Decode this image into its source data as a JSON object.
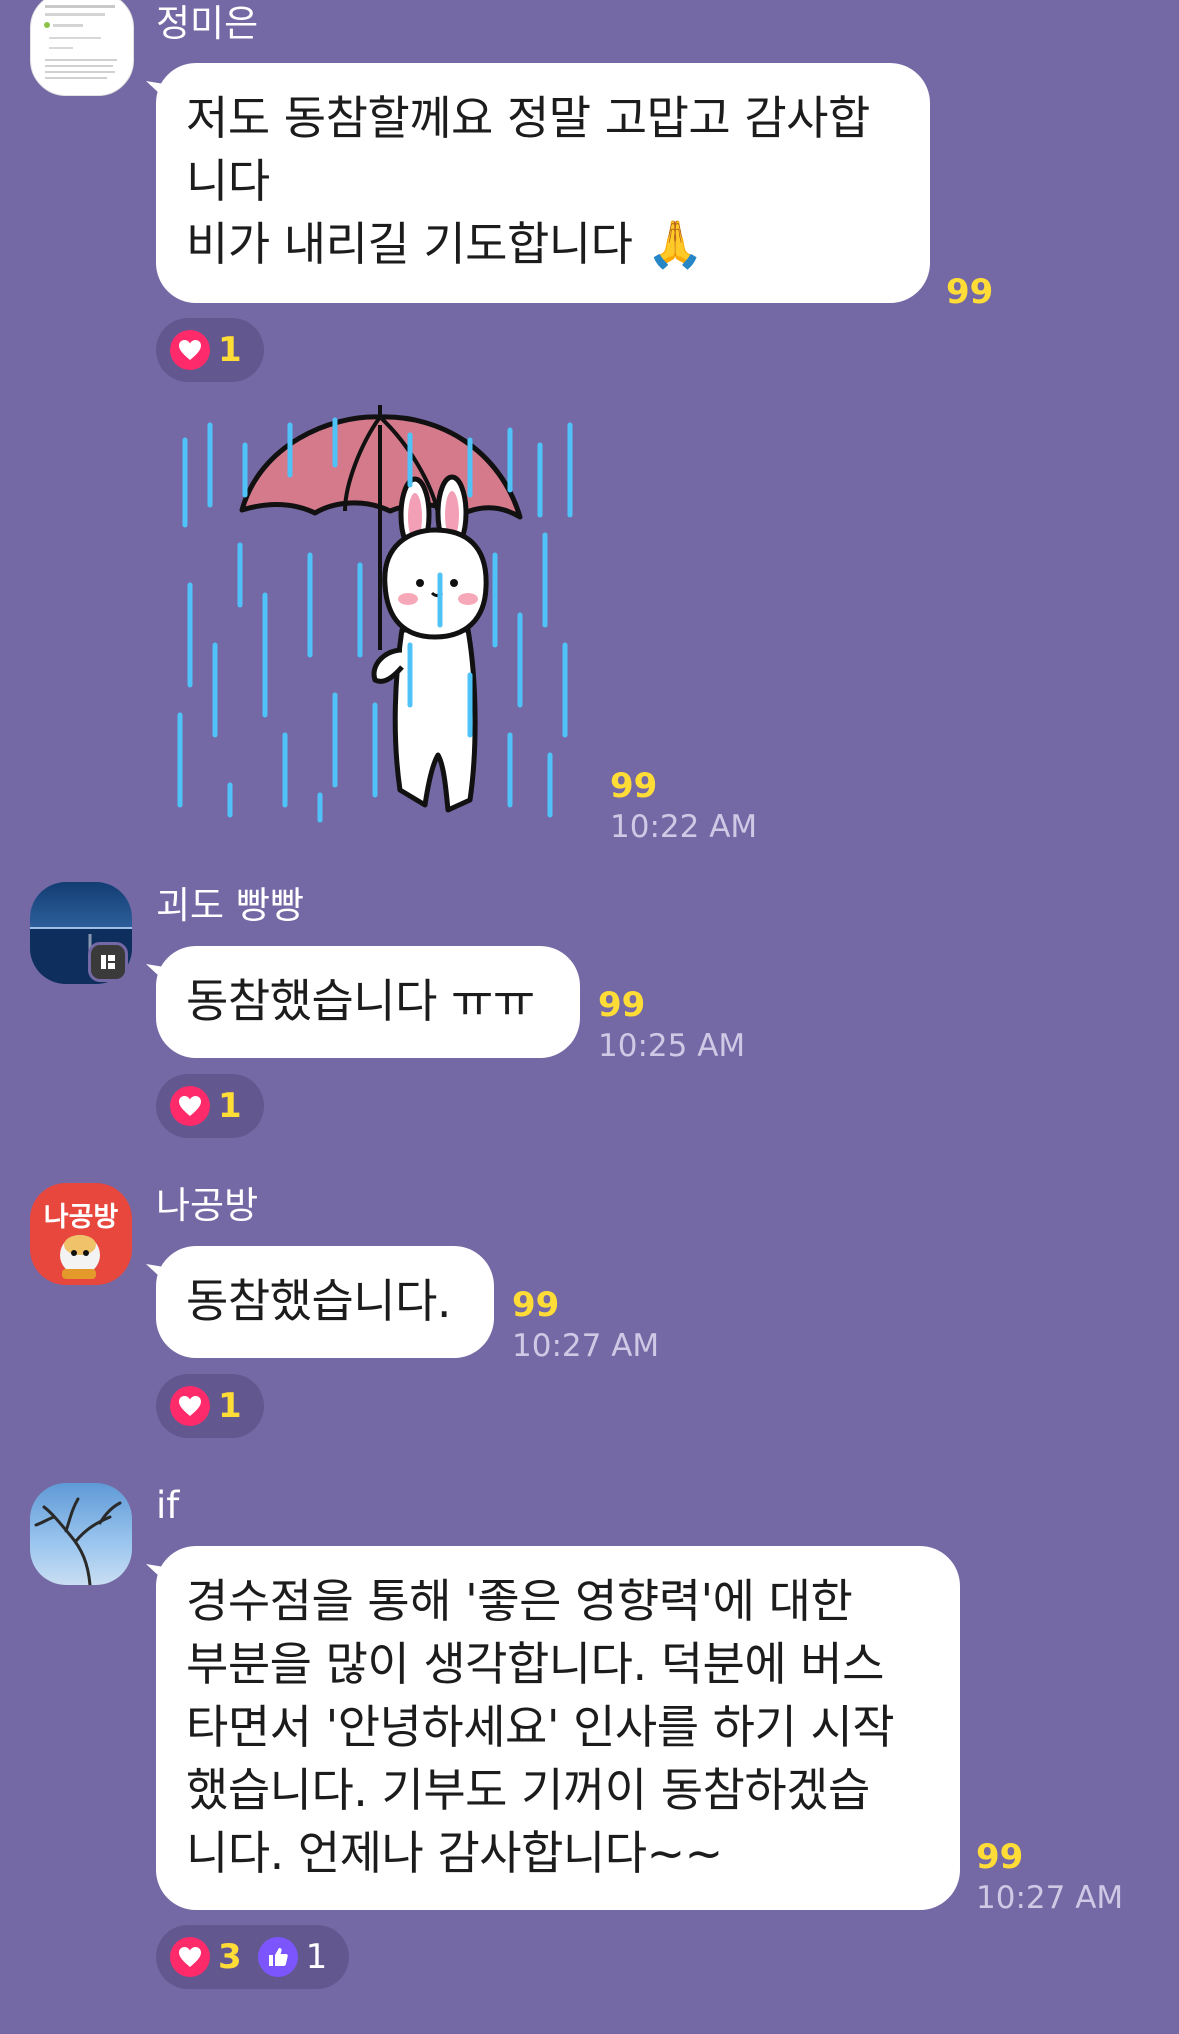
{
  "messages": [
    {
      "sender": "정미은",
      "text": "저도 동참할께요 정말 고맙고 감사합\n니다\n비가 내리길 기도합니다 🙏",
      "unread": "99",
      "reactions": {
        "heart": "1"
      }
    },
    {
      "sticker": "rabbit-umbrella-rain",
      "unread": "99",
      "time": "10:22 AM"
    },
    {
      "sender": "괴도 빵빵",
      "text": "동참했습니다 ㅠㅠ",
      "unread": "99",
      "time": "10:25 AM",
      "reactions": {
        "heart": "1"
      }
    },
    {
      "sender": "나공방",
      "avatar_text": "나공방",
      "text": "동참했습니다.",
      "unread": "99",
      "time": "10:27 AM",
      "reactions": {
        "heart": "1"
      }
    },
    {
      "sender": "if",
      "text": "경수점을 통해 '좋은 영향력'에 대한\n부분을 많이 생각합니다. 덕분에 버스\n타면서 '안녕하세요' 인사를 하기 시작\n했습니다. 기부도 기꺼이 동참하겠습\n니다. 언제나 감사합니다~~",
      "unread": "99",
      "time": "10:27 AM",
      "reactions": {
        "heart": "3",
        "thumbs_up": "1"
      }
    }
  ],
  "colors": {
    "background": "#7469a4",
    "bubble": "#ffffff",
    "unread": "#ffdc36",
    "heart": "#ff2a6a",
    "thumb": "#7c55ff"
  },
  "icons": [
    "heart-icon",
    "thumbs-up-icon",
    "pray-emoji"
  ]
}
